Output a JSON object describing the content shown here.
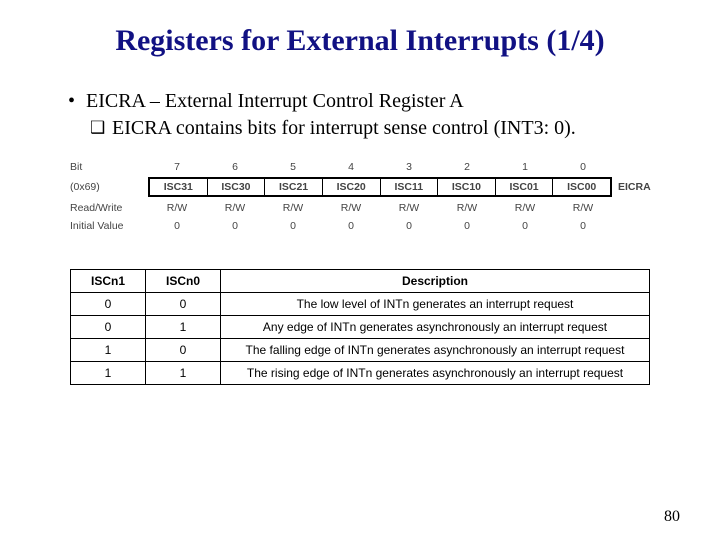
{
  "title": "Registers for External Interrupts (1/4)",
  "bullet_main": "EICRA – External Interrupt Control Register A",
  "bullet_sub": "EICRA contains bits for interrupt sense control (INT3: 0). ",
  "reg": {
    "addr": "(0x69)",
    "bit_label": "Bit",
    "rw_label": "Read/Write",
    "iv_label": "Initial Value",
    "name_after": "EICRA",
    "bit_nums": [
      "7",
      "6",
      "5",
      "4",
      "3",
      "2",
      "1",
      "0"
    ],
    "bit_names": [
      "ISC31",
      "ISC30",
      "ISC21",
      "ISC20",
      "ISC11",
      "ISC10",
      "ISC01",
      "ISC00"
    ],
    "rw": [
      "R/W",
      "R/W",
      "R/W",
      "R/W",
      "R/W",
      "R/W",
      "R/W",
      "R/W"
    ],
    "iv": [
      "0",
      "0",
      "0",
      "0",
      "0",
      "0",
      "0",
      "0"
    ]
  },
  "desc": {
    "h0": "ISCn1",
    "h1": "ISCn0",
    "h2": "Description",
    "rows": [
      {
        "c0": "0",
        "c1": "0",
        "d": "The low level of INTn generates an interrupt request"
      },
      {
        "c0": "0",
        "c1": "1",
        "d": "Any edge of INTn generates asynchronously an interrupt request"
      },
      {
        "c0": "1",
        "c1": "0",
        "d": "The falling edge of INTn generates asynchronously an interrupt request"
      },
      {
        "c0": "1",
        "c1": "1",
        "d": "The rising edge of INTn generates asynchronously an interrupt request"
      }
    ]
  },
  "page_number": "80"
}
